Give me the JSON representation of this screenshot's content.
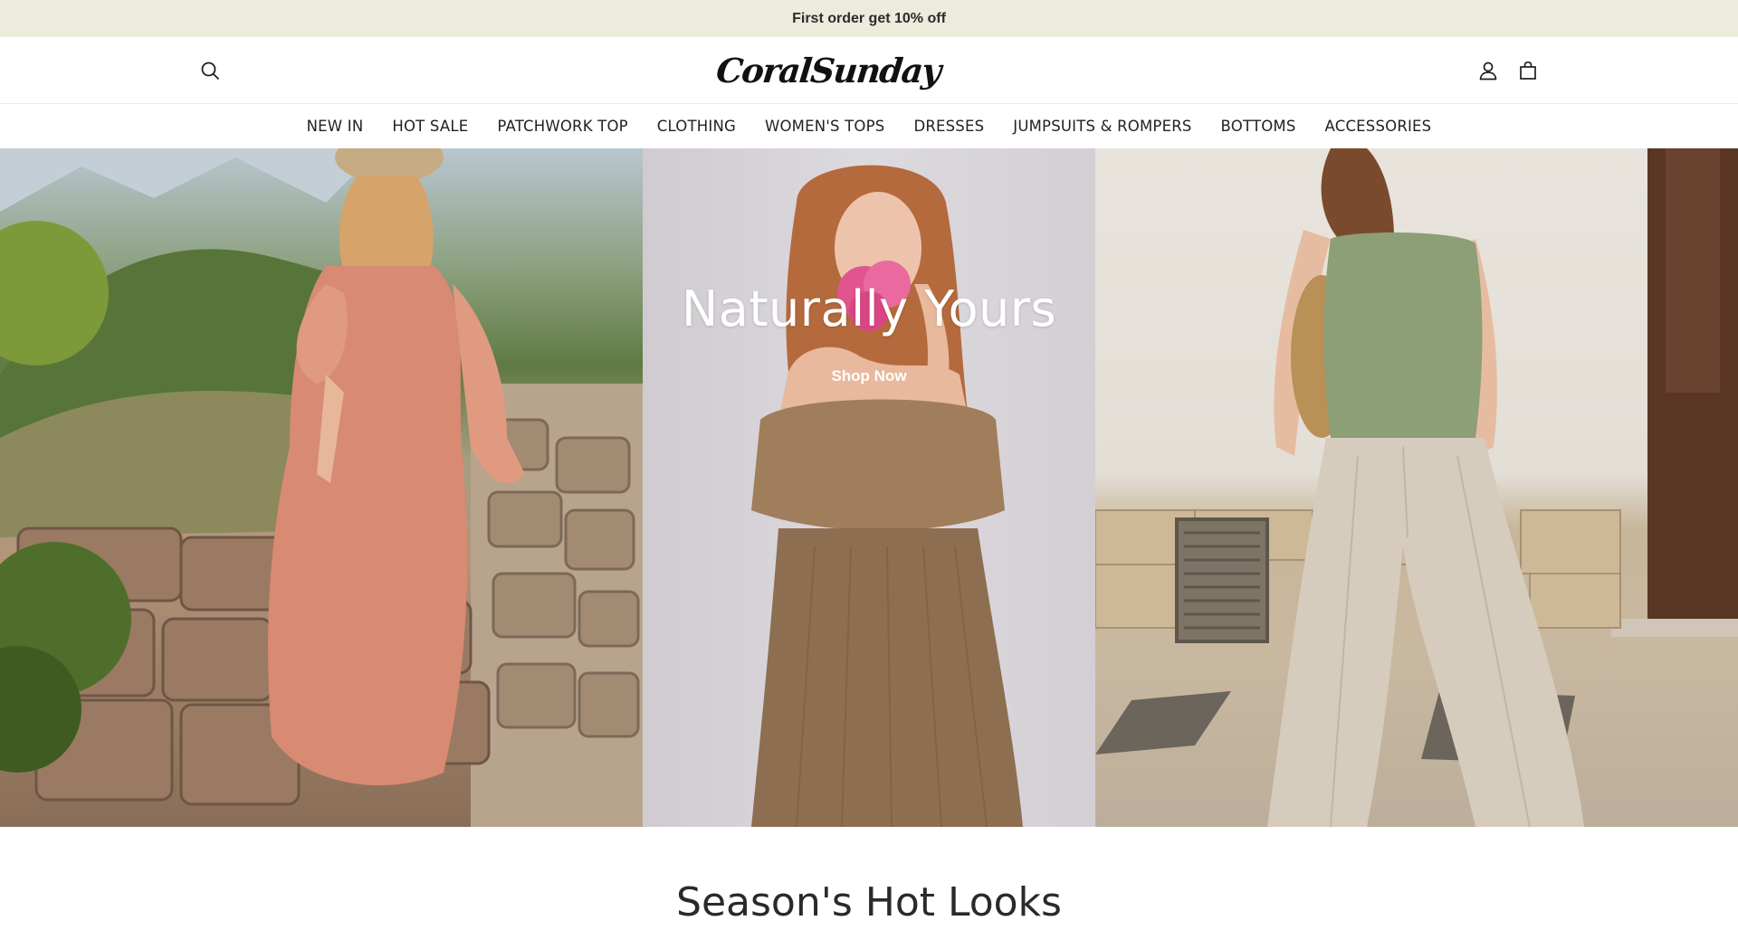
{
  "announcement": {
    "text": "First order get 10% off"
  },
  "header": {
    "logo_text": "CoralSunday",
    "icons": [
      "search-icon",
      "user-icon",
      "bag-icon"
    ]
  },
  "nav": {
    "items": [
      "NEW IN",
      "HOT SALE",
      "PATCHWORK TOP",
      "CLOTHING",
      "WOMEN'S TOPS",
      "DRESSES",
      "JUMPSUITS & ROMPERS",
      "BOTTOMS",
      "ACCESSORIES"
    ]
  },
  "hero": {
    "title": "Naturally Yours",
    "cta_label": "Shop Now"
  },
  "section": {
    "title": "Season's Hot Looks"
  },
  "colors": {
    "announcement_bg": "#ecebdc",
    "text": "#222222",
    "hero_text": "#ffffff"
  }
}
